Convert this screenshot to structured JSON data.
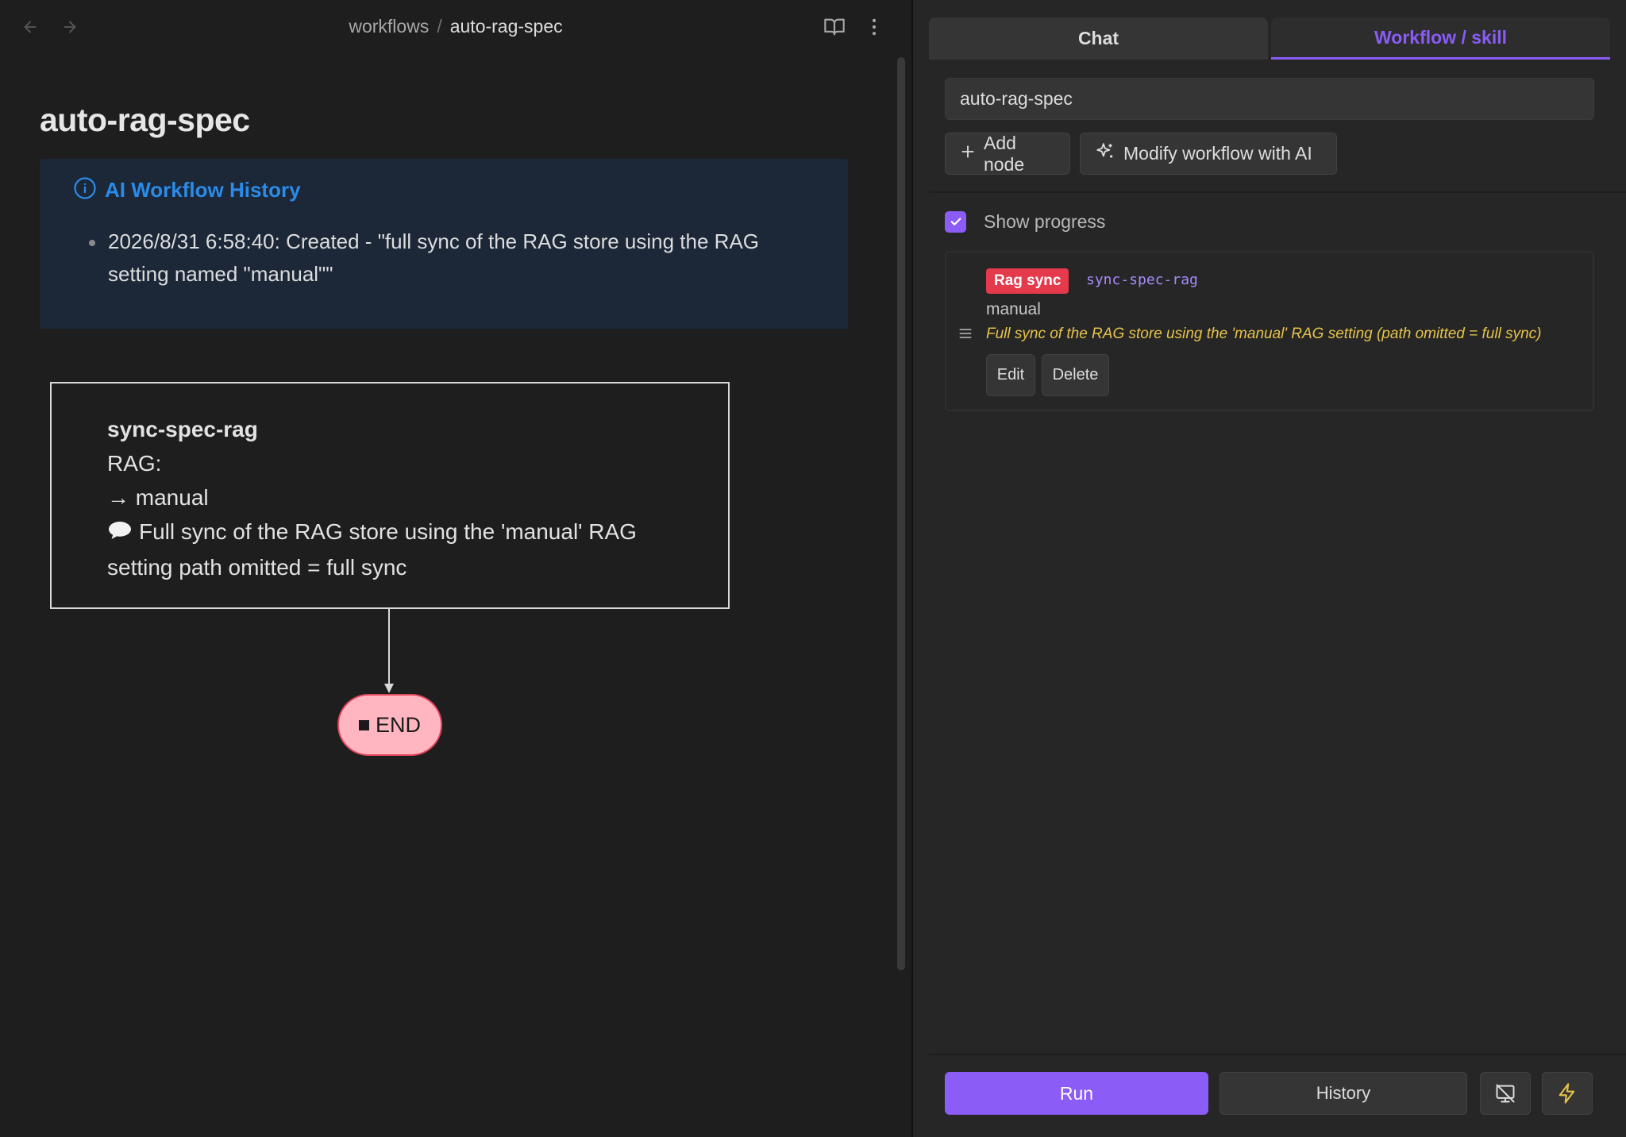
{
  "topbar": {
    "breadcrumb_parent": "workflows",
    "breadcrumb_separator": "/",
    "breadcrumb_current": "auto-rag-spec"
  },
  "page": {
    "title": "auto-rag-spec"
  },
  "callout": {
    "title": "AI Workflow History",
    "items": [
      "2026/8/31 6:58:40: Created - \"full sync of the RAG store using the RAG setting named \"manual\"\""
    ]
  },
  "diagram": {
    "node": {
      "name": "sync-spec-rag",
      "line_rag": "RAG:",
      "line_setting": "→ manual",
      "comment": "Full sync of the RAG store using the 'manual' RAG setting path omitted = full sync"
    },
    "end_label": "END"
  },
  "panel": {
    "tabs": [
      {
        "label": "Chat",
        "active": false
      },
      {
        "label": "Workflow / skill",
        "active": true
      }
    ],
    "workflow_name": "auto-rag-spec",
    "add_node_label": "Add node",
    "modify_ai_label": "Modify workflow with AI",
    "show_progress_label": "Show progress",
    "show_progress_checked": true,
    "node_card": {
      "type_badge": "Rag sync",
      "node_id": "sync-spec-rag",
      "setting": "manual",
      "comment": "Full sync of the RAG store using the 'manual' RAG setting (path omitted = full sync)",
      "edit_label": "Edit",
      "delete_label": "Delete"
    },
    "run_label": "Run",
    "history_label": "History"
  },
  "colors": {
    "accent": "#8b5cf6",
    "callout_title": "#2a8be8",
    "badge": "#e5394c",
    "end_node_fill": "#ffb6c1",
    "comment_text": "#e6c34a"
  },
  "icons": {
    "back": "arrow-left-icon",
    "forward": "arrow-right-icon",
    "book": "book-open-icon",
    "more": "more-vertical-icon",
    "info": "info-icon",
    "plus": "plus-icon",
    "sparkles": "sparkles-icon",
    "check": "check-icon",
    "drag": "drag-handle-icon",
    "monitor_off": "monitor-off-icon",
    "bolt": "lightning-icon"
  }
}
